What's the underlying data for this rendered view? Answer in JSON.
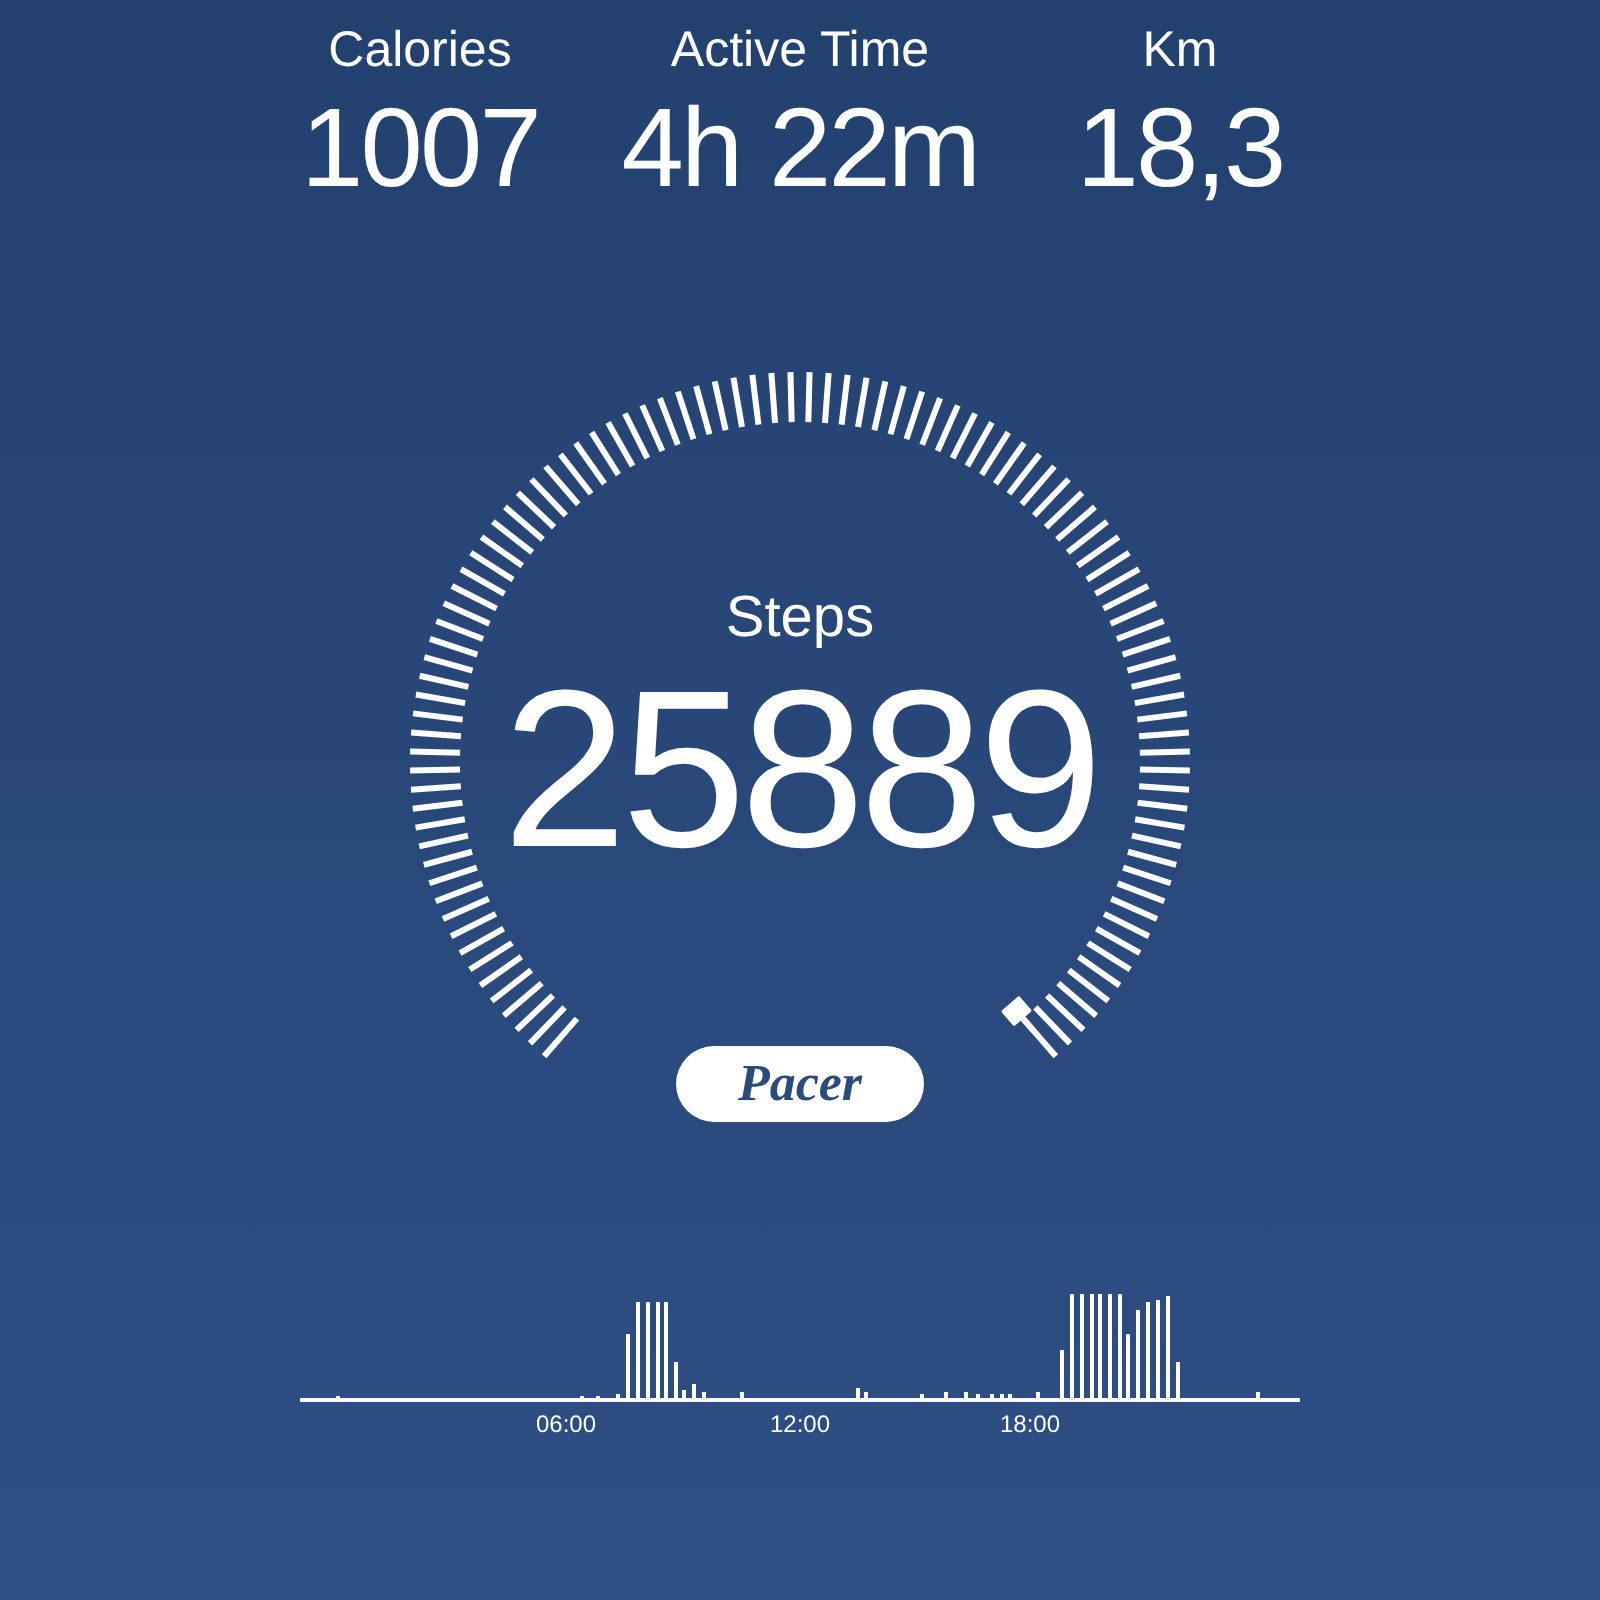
{
  "stats": [
    {
      "label": "Calories",
      "value": "1007"
    },
    {
      "label": "Active Time",
      "value": "4h 22m"
    },
    {
      "label": "Km",
      "value": "18,3"
    }
  ],
  "steps": {
    "label": "Steps",
    "value": "25889"
  },
  "logo": {
    "text": "Pacer"
  },
  "activity_chart": {
    "x_labels": [
      "06:00",
      "12:00",
      "18:00"
    ]
  }
}
